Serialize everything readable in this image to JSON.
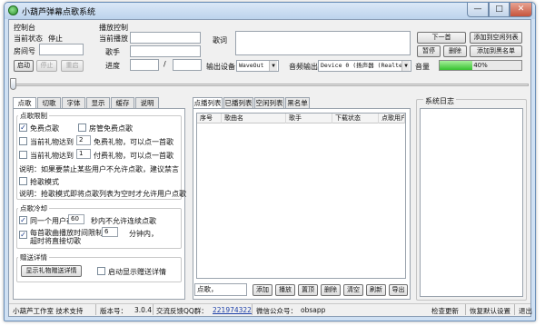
{
  "window": {
    "title": "小葫芦弹幕点歌系统",
    "min": "—",
    "max": "□",
    "close": "✕"
  },
  "control": {
    "heading": "控制台",
    "state_label": "当前状态",
    "state_value": "停止",
    "room_label": "房间号",
    "room_value": "",
    "start": "启动",
    "stop": "停止",
    "restart": "重启"
  },
  "playback": {
    "heading": "播放控制",
    "now_label": "当前播放",
    "now_value": "",
    "singer_label": "歌手",
    "singer_value": "",
    "progress_label": "进度",
    "progress_current": "",
    "progress_sep": "/",
    "progress_total": "",
    "lyrics_label": "歌词",
    "lyrics_value": "",
    "device_label": "输出设备",
    "device_value": "WaveOut",
    "audio_label": "音频输出",
    "audio_value": "Device 0 (扬声器 (Realtel",
    "volume_label": "音量",
    "volume_value": "40%",
    "volume_fraction": 0.4,
    "next": "下一首",
    "add_blank": "添加到空闲列表",
    "pause": "暂停",
    "delete": "删除",
    "add_black": "添加到黑名单"
  },
  "left_tabs": [
    "点歌",
    "切歌",
    "字体",
    "显示",
    "缓存",
    "说明"
  ],
  "song_limit": {
    "title": "点歌限制",
    "free": "免费点歌",
    "free_checked": true,
    "guard_free": "房管免费点歌",
    "guard_free_checked": false,
    "gift_free_pre": "当前礼物达到",
    "gift_free_num": "2",
    "gift_free_post": "免费礼物，可以点一首歌",
    "gift_free_checked": false,
    "gift_paid_pre": "当前礼物达到",
    "gift_paid_num": "1",
    "gift_paid_post": "付费礼物，可以点一首歌",
    "gift_paid_checked": false,
    "note1": "说明：如果要禁止某些用户不允许点歌，建议禁言",
    "grab": "抢歌模式",
    "grab_checked": false,
    "note2": "说明：抢歌模式即将点歌列表为空时才允许用户点歌"
  },
  "cooldown": {
    "title": "点歌冷却",
    "same_user_pre": "同一个用户在",
    "same_user_num": "60",
    "same_user_post": "秒内不允许连续点歌",
    "same_user_checked": true,
    "each_pre": "每首歌曲播放时间限制在",
    "each_num": "6",
    "each_post": "分钟内，",
    "each_post2": "超时将直接切歌",
    "each_checked": true
  },
  "gift_detail": {
    "title": "赠送详情",
    "show_button": "显示礼物赠送详情",
    "auto": "启动显示赠送详情",
    "auto_checked": false
  },
  "list_tabs": [
    "点播列表",
    "已播列表",
    "空闲列表",
    "黑名单"
  ],
  "table": {
    "columns": [
      "序号",
      "歌曲名",
      "歌手",
      "下载状态",
      "点歌用户"
    ],
    "rows": []
  },
  "list_controls": {
    "input_value": "点歌，",
    "buttons": [
      "添加",
      "播放",
      "置顶",
      "删除",
      "清空",
      "刷新",
      "导出"
    ]
  },
  "log": {
    "title": "系统日志"
  },
  "status": {
    "studio": "小葫芦工作室 技术支持",
    "version_label": "版本号：",
    "version": "3.0.4",
    "qq_label": "交流反馈QQ群：",
    "qq": "221974322",
    "wechat_label": "微信公众号：",
    "wechat": "obsapp",
    "check_update": "检查更新",
    "restore_defaults": "恢复默认设置",
    "exit": "退出"
  }
}
